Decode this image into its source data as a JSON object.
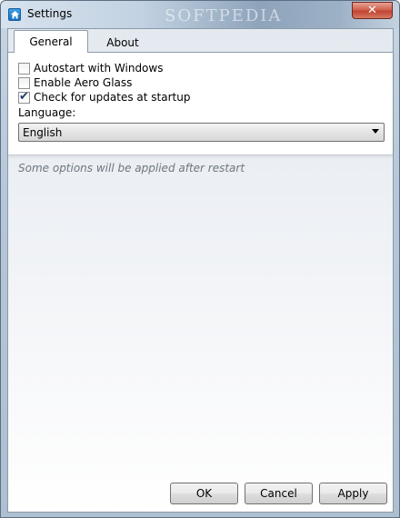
{
  "window": {
    "title": "Settings",
    "watermark": "SOFTPEDIA",
    "close_label": "✕"
  },
  "tabs": [
    {
      "label": "General",
      "active": true
    },
    {
      "label": "About",
      "active": false
    }
  ],
  "general": {
    "options": [
      {
        "label": "Autostart with Windows",
        "checked": false
      },
      {
        "label": "Enable Aero Glass",
        "checked": false
      },
      {
        "label": "Check for updates at startup",
        "checked": true
      }
    ],
    "language_label": "Language:",
    "language_value": "English"
  },
  "note": "Some options will be applied after restart",
  "buttons": {
    "ok": "OK",
    "cancel": "Cancel",
    "apply": "Apply"
  },
  "colors": {
    "accent": "#1a6fbf",
    "close": "#c24432"
  },
  "icons": {
    "app": "home-icon",
    "close": "close-icon",
    "dropdown": "chevron-down-icon",
    "check": "checkmark-icon"
  }
}
